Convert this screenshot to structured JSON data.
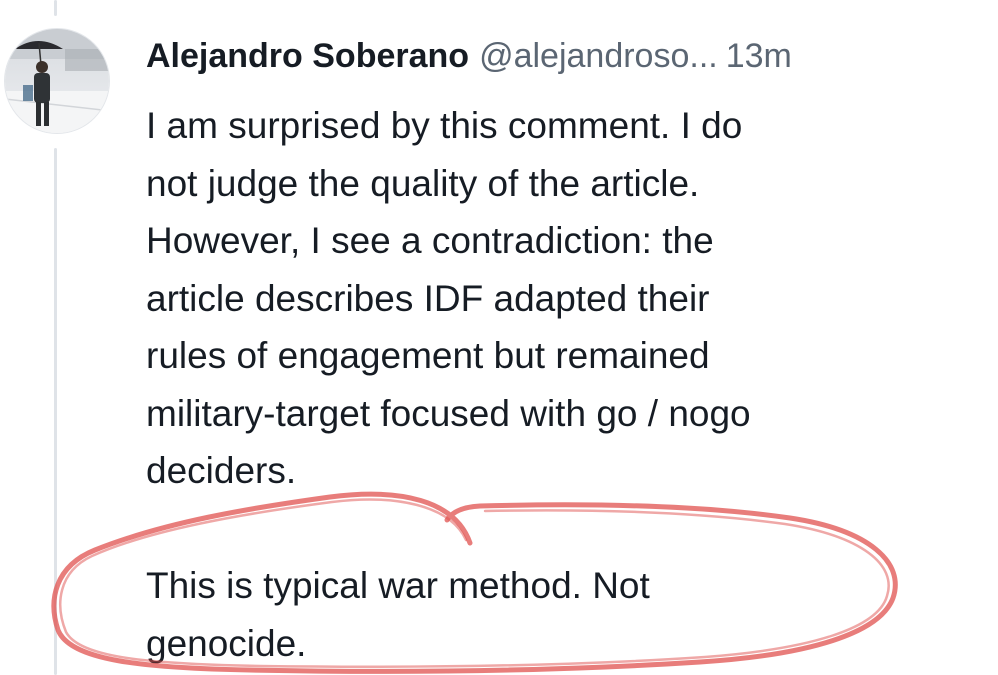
{
  "post": {
    "author_name": "Alejandro Soberano",
    "handle": "@alejandroso...",
    "timestamp": "13m",
    "paragraph_1": "I am surprised by this comment. I do\nnot judge the quality of the article.\nHowever, I see a contradiction: the\narticle describes IDF adapted their\nrules of engagement but remained\nmilitary-target focused with go / nogo\ndeciders.",
    "paragraph_2": "This is typical war method. Not\ngenocide."
  },
  "annotation": {
    "color": "#e0524f"
  }
}
